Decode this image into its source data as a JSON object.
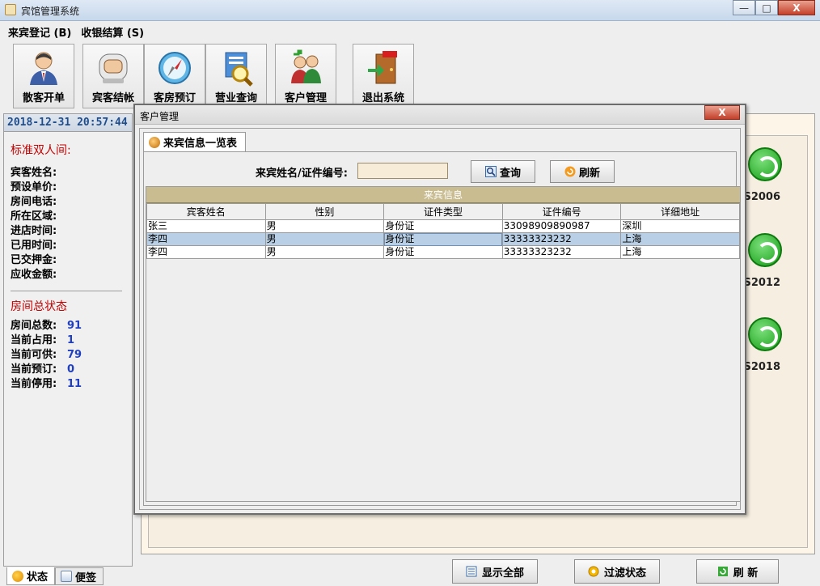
{
  "window": {
    "title": "宾馆管理系统",
    "minimize": "—",
    "maximize": "□",
    "close": "X"
  },
  "menu": [
    {
      "label": "来宾登记 (B)"
    },
    {
      "label": "收银结算 (S)"
    }
  ],
  "toolbar": [
    {
      "label": "散客开单",
      "icon": "guest-person-icon"
    },
    {
      "label": "宾客结帐",
      "icon": "checkout-robot-icon"
    },
    {
      "label": "客房预订",
      "icon": "compass-icon"
    },
    {
      "label": "营业查询",
      "icon": "magnifier-icon"
    },
    {
      "label": "客户管理",
      "icon": "customers-icon"
    },
    {
      "label": "退出系统",
      "icon": "exit-door-icon"
    }
  ],
  "left_panel": {
    "datetime": "2018-12-31  20:57:44",
    "room_type": "标准双人间:",
    "fields": [
      "宾客姓名:",
      "预设单价:",
      "房间电话:",
      "所在区域:",
      "进店时间:",
      "已用时间:",
      "已交押金:",
      "应收金额:"
    ],
    "status_title": "房间总状态",
    "stats": [
      {
        "label": "房间总数:",
        "value": "91"
      },
      {
        "label": "当前占用:",
        "value": "1"
      },
      {
        "label": "当前可供:",
        "value": "79"
      },
      {
        "label": "当前预订:",
        "value": "0"
      },
      {
        "label": "当前停用:",
        "value": "11"
      }
    ],
    "tabs": [
      {
        "label": "状态"
      },
      {
        "label": "便签"
      }
    ]
  },
  "rooms": [
    {
      "label": "S2006"
    },
    {
      "label": "S2012"
    },
    {
      "label": "S2018"
    }
  ],
  "bottom_buttons": [
    {
      "label": "显示全部"
    },
    {
      "label": "过滤状态"
    },
    {
      "label": "刷  新"
    }
  ],
  "dialog": {
    "title": "客户管理",
    "close": "X",
    "tab": "来宾信息一览表",
    "search_label": "来宾姓名/证件编号:",
    "search_value": "",
    "query_button": "查询",
    "refresh_button": "刷新",
    "table_caption": "来宾信息",
    "columns": [
      "宾客姓名",
      "性别",
      "证件类型",
      "证件编号",
      "详细地址"
    ],
    "rows": [
      [
        "张三",
        "男",
        "身份证",
        "33098909890987",
        "深圳"
      ],
      [
        "李四",
        "男",
        "身份证",
        "33333323232",
        "上海"
      ],
      [
        "李四",
        "男",
        "身份证",
        "33333323232",
        "上海"
      ]
    ],
    "selected_row": 1
  },
  "colors": {
    "accent_red": "#c40000",
    "stat_blue": "#1f3fbf",
    "table_caption_bg": "#c8bc90",
    "selection": "#b8cfe5"
  }
}
